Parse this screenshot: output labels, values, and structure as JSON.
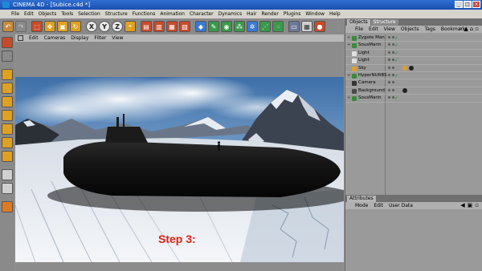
{
  "window": {
    "title": "CINEMA 4D - [Subice.c4d *]",
    "buttons": [
      "_",
      "□",
      "×"
    ]
  },
  "menubar": [
    "File",
    "Edit",
    "Objects",
    "Tools",
    "Selection",
    "Structure",
    "Functions",
    "Animation",
    "Character",
    "Dynamics",
    "Hair",
    "Render",
    "Plugins",
    "Window",
    "Help"
  ],
  "toolbar": {
    "axis_x": "X",
    "axis_y": "Y",
    "axis_z": "Z"
  },
  "viewport": {
    "menu": [
      "Edit",
      "Cameras",
      "Display",
      "Filter",
      "View"
    ],
    "step_text": "Step 3:"
  },
  "object_manager": {
    "tabs": [
      "Objects",
      "Structure"
    ],
    "menu": [
      "File",
      "Edit",
      "View",
      "Objects",
      "Tags",
      "Bookmarks"
    ],
    "items": [
      {
        "name": "Zygote Man",
        "expand": "+",
        "icon_color": "#3a8a3a",
        "checked": true,
        "tag": "",
        "tag2": ""
      },
      {
        "name": "SousMarin",
        "expand": "+",
        "icon_color": "#3a8a3a",
        "checked": true,
        "tag": "",
        "tag2": ""
      },
      {
        "name": "Light",
        "expand": "",
        "icon_color": "#e0e0e0",
        "checked": true,
        "tag": "",
        "tag2": ""
      },
      {
        "name": "Light",
        "expand": "",
        "icon_color": "#e0e0e0",
        "checked": true,
        "tag": "",
        "tag2": ""
      },
      {
        "name": "Sky",
        "expand": "",
        "icon_color": "#d9a030",
        "checked": false,
        "tag": "#d9a030",
        "tag2": "#222222"
      },
      {
        "name": "HyperNURBS",
        "expand": "+",
        "icon_color": "#3a8a3a",
        "checked": true,
        "tag": "",
        "tag2": ""
      },
      {
        "name": "Camera",
        "expand": "",
        "icon_color": "#333333",
        "checked": false,
        "tag": "",
        "tag2": ""
      },
      {
        "name": "Background",
        "expand": "",
        "icon_color": "#4a4a4a",
        "checked": false,
        "tag": "#222222",
        "tag2": ""
      },
      {
        "name": "SousMarin",
        "expand": "+",
        "icon_color": "#3a8a3a",
        "checked": true,
        "tag": "",
        "tag2": ""
      }
    ]
  },
  "attributes_manager": {
    "tab": "Attributes",
    "menu": [
      "Mode",
      "Edit",
      "User Data"
    ]
  }
}
